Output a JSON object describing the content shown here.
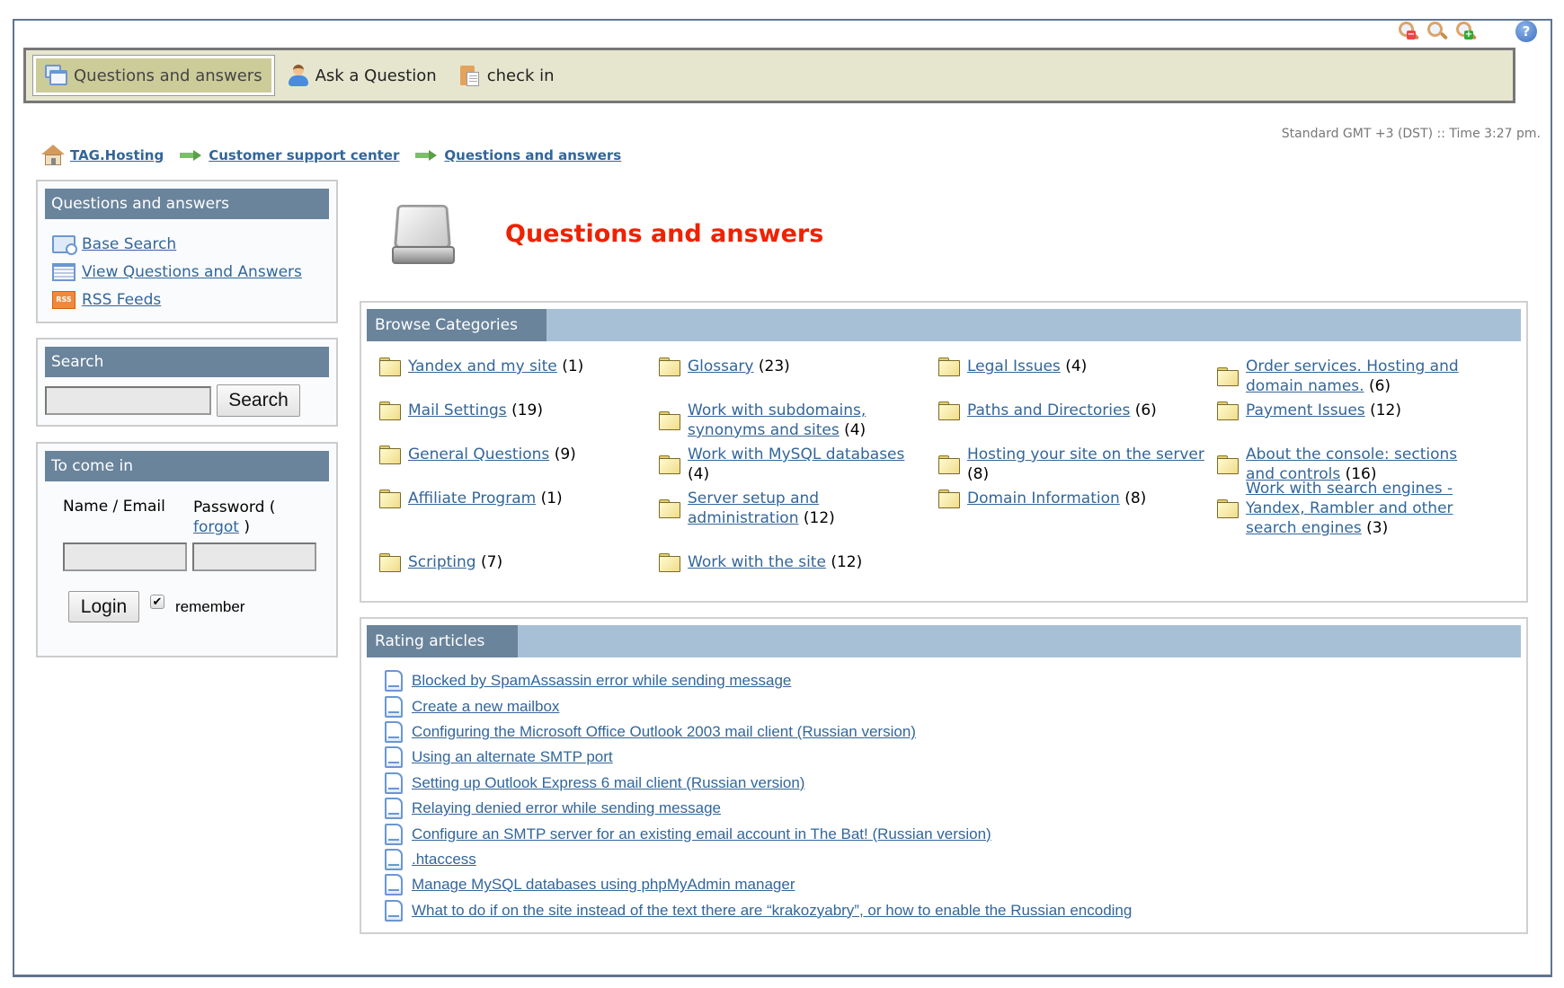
{
  "toolbar": {
    "zoom_out": "zoom-out",
    "zoom_reset": "zoom-reset",
    "zoom_in": "zoom-in",
    "help": "?"
  },
  "nav": {
    "items": [
      {
        "label": "Questions and answers",
        "icon": "windows-icon",
        "active": true
      },
      {
        "label": "Ask a Question",
        "icon": "person-icon",
        "active": false
      },
      {
        "label": "check in",
        "icon": "clipboard-icon",
        "active": false
      }
    ]
  },
  "timezone": "Standard GMT +3 (DST) :: Time 3:27 pm.",
  "breadcrumb": [
    "TAG.Hosting",
    "Customer support center",
    "Questions and answers"
  ],
  "sidebar": {
    "qa_box": {
      "title": "Questions and answers",
      "links": [
        "Base Search",
        "View Questions and Answers",
        "RSS Feeds"
      ]
    },
    "search_box": {
      "title": "Search",
      "input_value": "",
      "button": "Search"
    },
    "login_box": {
      "title": "To come in",
      "name_label": "Name / Email",
      "password_label": "Password (",
      "forgot": "forgot",
      "close_paren": ")",
      "name_value": "",
      "password_value": "",
      "login_button": "Login",
      "remember_label": "remember",
      "remember_checked": true
    }
  },
  "main": {
    "title": "Questions and answers",
    "title_color": "#ee2200",
    "categories_title": "Browse Categories",
    "categories": [
      {
        "name": "Yandex and my site",
        "count": "(1)"
      },
      {
        "name": "Glossary",
        "count": "(23)"
      },
      {
        "name": "Legal Issues",
        "count": "(4)"
      },
      {
        "name": "Order services. Hosting and domain names.",
        "count": "(6)"
      },
      {
        "name": "Mail Settings",
        "count": "(19)"
      },
      {
        "name": "Work with subdomains, synonyms and sites",
        "count": "(4)"
      },
      {
        "name": "Paths and Directories",
        "count": "(6)"
      },
      {
        "name": "Payment Issues",
        "count": "(12)"
      },
      {
        "name": "General Questions",
        "count": "(9)"
      },
      {
        "name": "Work with MySQL databases",
        "count": "(4)"
      },
      {
        "name": "Hosting your site on the server",
        "count": "(8)"
      },
      {
        "name": "About the console: sections and controls",
        "count": "(16)"
      },
      {
        "name": "Affiliate Program",
        "count": "(1)"
      },
      {
        "name": "Server setup and administration",
        "count": "(12)"
      },
      {
        "name": "Domain Information",
        "count": "(8)"
      },
      {
        "name": "Work with search engines - Yandex, Rambler and other search engines",
        "count": "(3)"
      },
      {
        "name": "Scripting",
        "count": "(7)"
      },
      {
        "name": "Work with the site",
        "count": "(12)"
      }
    ],
    "rating_title": "Rating articles",
    "articles": [
      "Blocked by SpamAssassin error while sending message",
      "Create a new mailbox",
      "Configuring the Microsoft Office Outlook 2003 mail client (Russian version)",
      "Using an alternate SMTP port",
      "Setting up Outlook Express 6 mail client (Russian version)",
      "Relaying denied error while sending message",
      "Configure an SMTP server for an existing email account in The Bat! (Russian version)",
      ".htaccess",
      "Manage MySQL databases using phpMyAdmin manager",
      "What to do if on the site instead of the text there are “krakozyabry”, or how to enable the Russian encoding"
    ]
  }
}
